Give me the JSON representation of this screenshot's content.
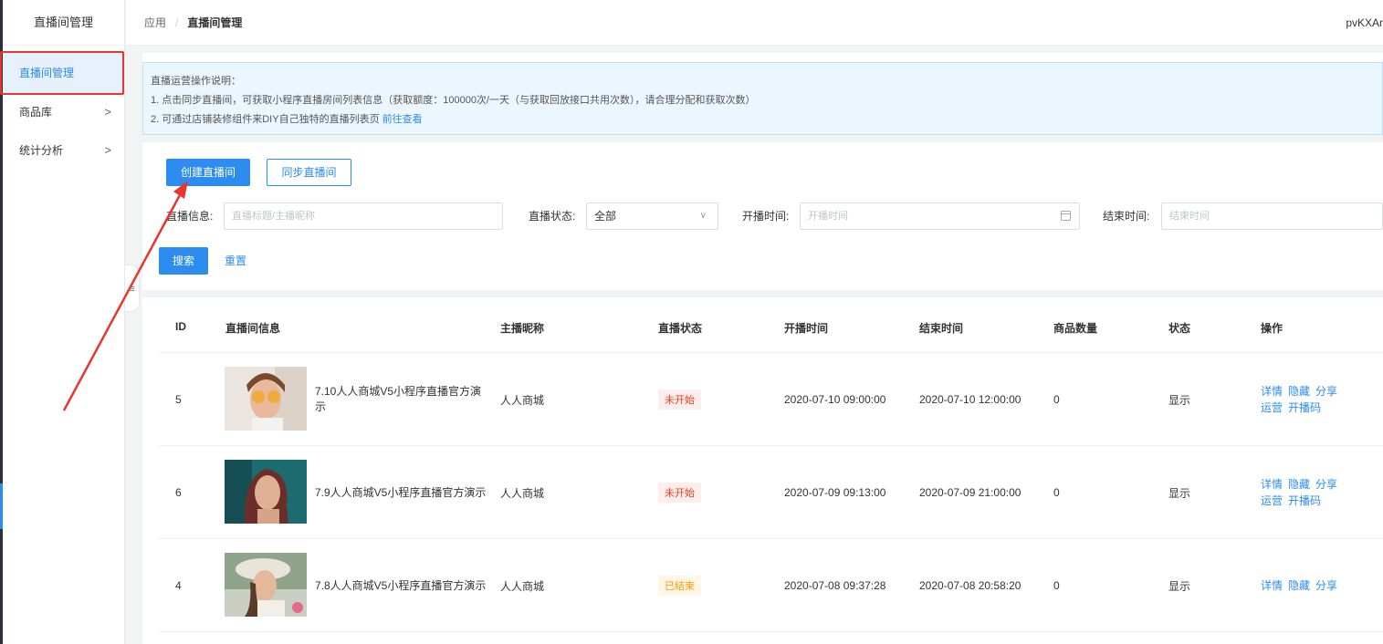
{
  "sidebar": {
    "title": "直播间管理",
    "items": [
      {
        "label": "直播间管理",
        "chevron": ""
      },
      {
        "label": "商品库",
        "chevron": ">"
      },
      {
        "label": "统计分析",
        "chevron": ">"
      }
    ]
  },
  "header": {
    "breadcrumb": [
      "应用",
      "直播间管理"
    ],
    "separator": "/",
    "user": "pvKXAr"
  },
  "notice": {
    "title": "直播运营操作说明：",
    "line1": "1. 点击同步直播间，可获取小程序直播房间列表信息（获取额度：100000次/一天（与获取回放接口共用次数），请合理分配和获取次数）",
    "line2": "2. 可通过店铺装修组件来DIY自己独特的直播列表页",
    "line2_link": "前往查看"
  },
  "toolbar": {
    "create_label": "创建直播间",
    "sync_label": "同步直播间"
  },
  "filters": {
    "info_label": "直播信息:",
    "info_placeholder": "直播标题/主播昵称",
    "status_label": "直播状态:",
    "status_value": "全部",
    "start_label": "开播时间:",
    "start_placeholder": "开播时间",
    "end_label": "结束时间:",
    "end_placeholder": "结束时间",
    "search_label": "搜索",
    "reset_label": "重置"
  },
  "table": {
    "columns": [
      "ID",
      "直播间信息",
      "主播昵称",
      "直播状态",
      "开播时间",
      "结束时间",
      "商品数量",
      "状态",
      "操作"
    ],
    "rows": [
      {
        "id": "5",
        "title": "7.10人人商城V5小程序直播官方演示",
        "anchor": "人人商城",
        "live_status": "未开始",
        "start": "2020-07-10 09:00:00",
        "end": "2020-07-10 12:00:00",
        "goods": "0",
        "state": "显示",
        "ops1": [
          "详情",
          "隐藏",
          "分享"
        ],
        "ops2": [
          "运营",
          "开播码"
        ]
      },
      {
        "id": "6",
        "title": "7.9人人商城V5小程序直播官方演示",
        "anchor": "人人商城",
        "live_status": "未开始",
        "start": "2020-07-09 09:13:00",
        "end": "2020-07-09 21:00:00",
        "goods": "0",
        "state": "显示",
        "ops1": [
          "详情",
          "隐藏",
          "分享"
        ],
        "ops2": [
          "运营",
          "开播码"
        ]
      },
      {
        "id": "4",
        "title": "7.8人人商城V5小程序直播官方演示",
        "anchor": "人人商城",
        "live_status": "已结束",
        "start": "2020-07-08 09:37:28",
        "end": "2020-07-08 20:58:20",
        "goods": "0",
        "state": "显示",
        "ops1": [
          "详情",
          "隐藏",
          "分享"
        ],
        "ops2": []
      }
    ]
  },
  "colors": {
    "primary": "#2d8cf0",
    "danger": "#ed4014",
    "warning": "#ff9900",
    "annotation": "#e8362c"
  }
}
